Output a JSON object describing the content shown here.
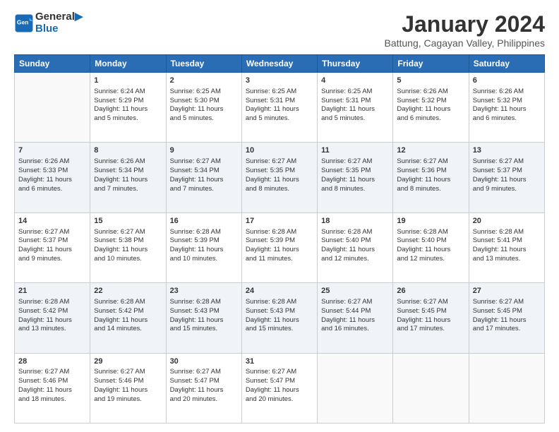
{
  "logo": {
    "line1": "General",
    "line2": "Blue"
  },
  "header": {
    "title": "January 2024",
    "subtitle": "Battung, Cagayan Valley, Philippines"
  },
  "weekdays": [
    "Sunday",
    "Monday",
    "Tuesday",
    "Wednesday",
    "Thursday",
    "Friday",
    "Saturday"
  ],
  "weeks": [
    [
      {
        "day": null,
        "info": null
      },
      {
        "day": "1",
        "info": "Sunrise: 6:24 AM\nSunset: 5:29 PM\nDaylight: 11 hours\nand 5 minutes."
      },
      {
        "day": "2",
        "info": "Sunrise: 6:25 AM\nSunset: 5:30 PM\nDaylight: 11 hours\nand 5 minutes."
      },
      {
        "day": "3",
        "info": "Sunrise: 6:25 AM\nSunset: 5:31 PM\nDaylight: 11 hours\nand 5 minutes."
      },
      {
        "day": "4",
        "info": "Sunrise: 6:25 AM\nSunset: 5:31 PM\nDaylight: 11 hours\nand 5 minutes."
      },
      {
        "day": "5",
        "info": "Sunrise: 6:26 AM\nSunset: 5:32 PM\nDaylight: 11 hours\nand 6 minutes."
      },
      {
        "day": "6",
        "info": "Sunrise: 6:26 AM\nSunset: 5:32 PM\nDaylight: 11 hours\nand 6 minutes."
      }
    ],
    [
      {
        "day": "7",
        "info": "Sunrise: 6:26 AM\nSunset: 5:33 PM\nDaylight: 11 hours\nand 6 minutes."
      },
      {
        "day": "8",
        "info": "Sunrise: 6:26 AM\nSunset: 5:34 PM\nDaylight: 11 hours\nand 7 minutes."
      },
      {
        "day": "9",
        "info": "Sunrise: 6:27 AM\nSunset: 5:34 PM\nDaylight: 11 hours\nand 7 minutes."
      },
      {
        "day": "10",
        "info": "Sunrise: 6:27 AM\nSunset: 5:35 PM\nDaylight: 11 hours\nand 8 minutes."
      },
      {
        "day": "11",
        "info": "Sunrise: 6:27 AM\nSunset: 5:35 PM\nDaylight: 11 hours\nand 8 minutes."
      },
      {
        "day": "12",
        "info": "Sunrise: 6:27 AM\nSunset: 5:36 PM\nDaylight: 11 hours\nand 8 minutes."
      },
      {
        "day": "13",
        "info": "Sunrise: 6:27 AM\nSunset: 5:37 PM\nDaylight: 11 hours\nand 9 minutes."
      }
    ],
    [
      {
        "day": "14",
        "info": "Sunrise: 6:27 AM\nSunset: 5:37 PM\nDaylight: 11 hours\nand 9 minutes."
      },
      {
        "day": "15",
        "info": "Sunrise: 6:27 AM\nSunset: 5:38 PM\nDaylight: 11 hours\nand 10 minutes."
      },
      {
        "day": "16",
        "info": "Sunrise: 6:28 AM\nSunset: 5:39 PM\nDaylight: 11 hours\nand 10 minutes."
      },
      {
        "day": "17",
        "info": "Sunrise: 6:28 AM\nSunset: 5:39 PM\nDaylight: 11 hours\nand 11 minutes."
      },
      {
        "day": "18",
        "info": "Sunrise: 6:28 AM\nSunset: 5:40 PM\nDaylight: 11 hours\nand 12 minutes."
      },
      {
        "day": "19",
        "info": "Sunrise: 6:28 AM\nSunset: 5:40 PM\nDaylight: 11 hours\nand 12 minutes."
      },
      {
        "day": "20",
        "info": "Sunrise: 6:28 AM\nSunset: 5:41 PM\nDaylight: 11 hours\nand 13 minutes."
      }
    ],
    [
      {
        "day": "21",
        "info": "Sunrise: 6:28 AM\nSunset: 5:42 PM\nDaylight: 11 hours\nand 13 minutes."
      },
      {
        "day": "22",
        "info": "Sunrise: 6:28 AM\nSunset: 5:42 PM\nDaylight: 11 hours\nand 14 minutes."
      },
      {
        "day": "23",
        "info": "Sunrise: 6:28 AM\nSunset: 5:43 PM\nDaylight: 11 hours\nand 15 minutes."
      },
      {
        "day": "24",
        "info": "Sunrise: 6:28 AM\nSunset: 5:43 PM\nDaylight: 11 hours\nand 15 minutes."
      },
      {
        "day": "25",
        "info": "Sunrise: 6:27 AM\nSunset: 5:44 PM\nDaylight: 11 hours\nand 16 minutes."
      },
      {
        "day": "26",
        "info": "Sunrise: 6:27 AM\nSunset: 5:45 PM\nDaylight: 11 hours\nand 17 minutes."
      },
      {
        "day": "27",
        "info": "Sunrise: 6:27 AM\nSunset: 5:45 PM\nDaylight: 11 hours\nand 17 minutes."
      }
    ],
    [
      {
        "day": "28",
        "info": "Sunrise: 6:27 AM\nSunset: 5:46 PM\nDaylight: 11 hours\nand 18 minutes."
      },
      {
        "day": "29",
        "info": "Sunrise: 6:27 AM\nSunset: 5:46 PM\nDaylight: 11 hours\nand 19 minutes."
      },
      {
        "day": "30",
        "info": "Sunrise: 6:27 AM\nSunset: 5:47 PM\nDaylight: 11 hours\nand 20 minutes."
      },
      {
        "day": "31",
        "info": "Sunrise: 6:27 AM\nSunset: 5:47 PM\nDaylight: 11 hours\nand 20 minutes."
      },
      {
        "day": null,
        "info": null
      },
      {
        "day": null,
        "info": null
      },
      {
        "day": null,
        "info": null
      }
    ]
  ]
}
